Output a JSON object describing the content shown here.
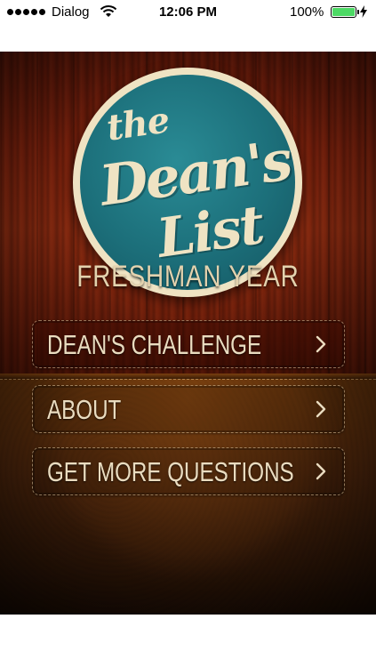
{
  "status_bar": {
    "carrier": "Dialog",
    "time": "12:06 PM",
    "battery_percent": "100%",
    "battery_color": "#4cd964",
    "signal_bars": 5,
    "wifi_icon": "wifi-icon",
    "charging_icon": "bolt-icon"
  },
  "app": {
    "logo": {
      "line1": "the",
      "line2": "Dean's",
      "line3": "List",
      "ring_color": "#efe3c3",
      "fill_color": "#1c6f7a"
    },
    "subtitle": "FRESHMAN YEAR",
    "menu": [
      {
        "label": "DEAN'S CHALLENGE",
        "icon": "chevron-right-icon"
      },
      {
        "label": "ABOUT",
        "icon": "chevron-right-icon"
      },
      {
        "label": "GET MORE QUESTIONS",
        "icon": "chevron-right-icon"
      }
    ]
  }
}
